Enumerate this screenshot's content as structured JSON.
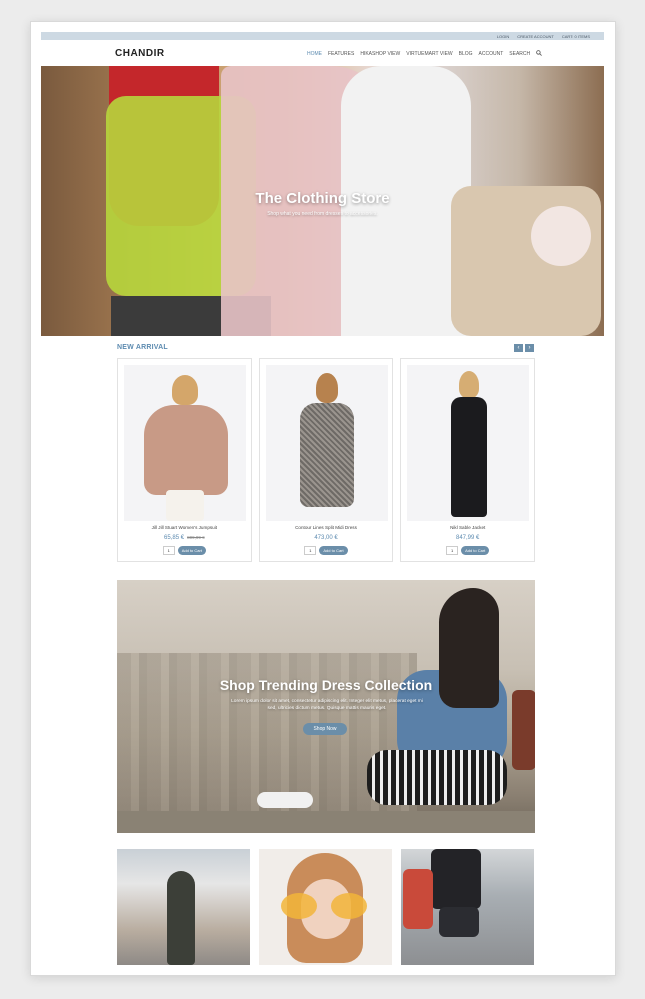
{
  "topbar": {
    "login": "LOGIN",
    "create_account": "CREATE ACCOUNT",
    "cart": "CART: 0 ITEMS"
  },
  "logo": "CHANDIR",
  "nav": [
    "HOME",
    "FEATURES",
    "HIKASHOP VIEW",
    "VIRTUEMART VIEW",
    "BLOG",
    "ACCOUNT",
    "SEARCH"
  ],
  "hero": {
    "title": "The Clothing Store",
    "subtitle": "Shop what you need from dresses to accessories."
  },
  "new_arrival": {
    "title": "NEW ARRIVAL",
    "prev": "‹",
    "next": "›"
  },
  "products": [
    {
      "name": "Jill Jill Stuart Women's Jumpsuit",
      "price": "65,85 €",
      "old_price": "809,99 €",
      "qty": "1",
      "button": "Add to Cart"
    },
    {
      "name": "Contour Lines Split Midi Dress",
      "price": "473,00 €",
      "old_price": "",
      "qty": "1",
      "button": "Add to Cart"
    },
    {
      "name": "Nikl Sable Jacket",
      "price": "847,99 €",
      "old_price": "",
      "qty": "1",
      "button": "Add to Cart"
    }
  ],
  "banner": {
    "title": "Shop Trending Dress Collection",
    "text": "Lorem ipsum dolor sit amet, consectetur adipiscing elit. Integer elit metus, placerat eget mi sed, ultricies dictum metus. Quisque mattis mauris eget.",
    "button": "Shop Now"
  }
}
